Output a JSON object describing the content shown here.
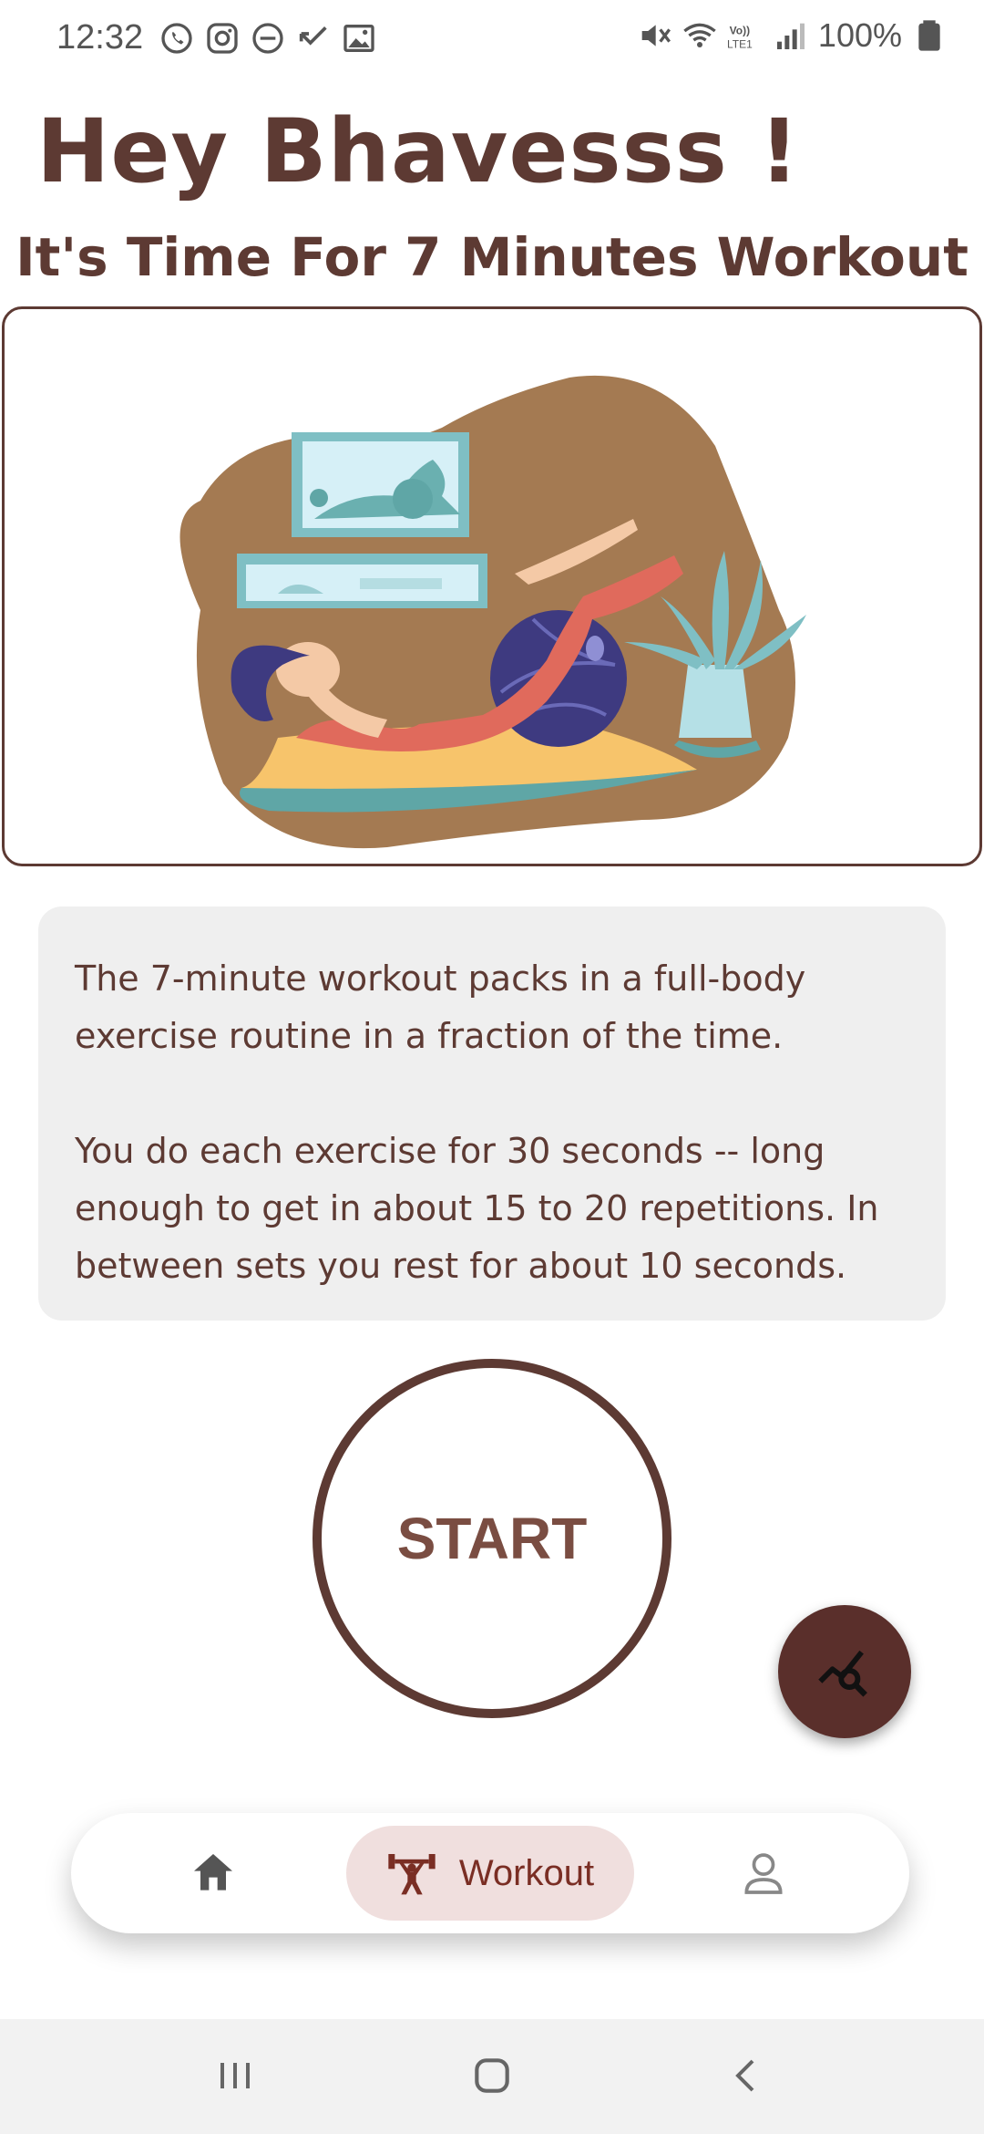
{
  "status_bar": {
    "time": "12:32",
    "battery": "100%",
    "left_icons": [
      "whatsapp-icon",
      "instagram-icon",
      "dnd-icon",
      "missed-call-icon",
      "gallery-icon"
    ],
    "right_icons": [
      "mute-icon",
      "wifi-icon",
      "volte-icon",
      "signal-icon",
      "battery-icon"
    ]
  },
  "header": {
    "greeting": "Hey Bhavesss !",
    "subtitle": "It's Time For 7 Minutes Workout"
  },
  "illustration": {
    "icon": "woman-exercise-ball-illustration"
  },
  "description": {
    "paragraph1": "The 7-minute workout packs in a full-body exercise routine in a fraction of the time.",
    "paragraph2": "You do each exercise for 30 seconds -- long enough to get in about 15 to 20 repetitions. In between sets you rest for about 10 seconds."
  },
  "start_button": {
    "label": "START"
  },
  "fab": {
    "icon": "chart-search-icon"
  },
  "bottom_nav": {
    "items": [
      {
        "icon": "home-icon",
        "label": "",
        "active": false
      },
      {
        "icon": "dumbbell-person-icon",
        "label": "Workout",
        "active": true
      },
      {
        "icon": "profile-icon",
        "label": "",
        "active": false
      }
    ]
  },
  "system_nav": {
    "icons": [
      "recent-apps-icon",
      "home-button-icon",
      "back-icon"
    ]
  },
  "colors": {
    "primary": "#5d3a33",
    "accent_bg": "#f0dfde",
    "fab_bg": "#5a2f2b",
    "description_bg": "#efefef"
  }
}
